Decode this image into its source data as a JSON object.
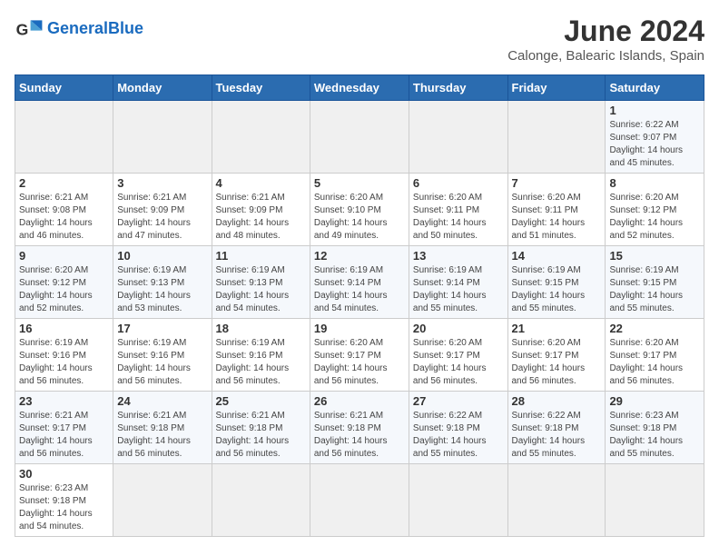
{
  "logo": {
    "text_general": "General",
    "text_blue": "Blue"
  },
  "title": "June 2024",
  "location": "Calonge, Balearic Islands, Spain",
  "days_of_week": [
    "Sunday",
    "Monday",
    "Tuesday",
    "Wednesday",
    "Thursday",
    "Friday",
    "Saturday"
  ],
  "weeks": [
    [
      {
        "day": "",
        "info": ""
      },
      {
        "day": "",
        "info": ""
      },
      {
        "day": "",
        "info": ""
      },
      {
        "day": "",
        "info": ""
      },
      {
        "day": "",
        "info": ""
      },
      {
        "day": "",
        "info": ""
      },
      {
        "day": "1",
        "info": "Sunrise: 6:22 AM\nSunset: 9:07 PM\nDaylight: 14 hours and 45 minutes."
      }
    ],
    [
      {
        "day": "2",
        "info": "Sunrise: 6:21 AM\nSunset: 9:08 PM\nDaylight: 14 hours and 46 minutes."
      },
      {
        "day": "3",
        "info": "Sunrise: 6:21 AM\nSunset: 9:09 PM\nDaylight: 14 hours and 47 minutes."
      },
      {
        "day": "4",
        "info": "Sunrise: 6:21 AM\nSunset: 9:09 PM\nDaylight: 14 hours and 48 minutes."
      },
      {
        "day": "5",
        "info": "Sunrise: 6:20 AM\nSunset: 9:10 PM\nDaylight: 14 hours and 49 minutes."
      },
      {
        "day": "6",
        "info": "Sunrise: 6:20 AM\nSunset: 9:11 PM\nDaylight: 14 hours and 50 minutes."
      },
      {
        "day": "7",
        "info": "Sunrise: 6:20 AM\nSunset: 9:11 PM\nDaylight: 14 hours and 51 minutes."
      },
      {
        "day": "8",
        "info": "Sunrise: 6:20 AM\nSunset: 9:12 PM\nDaylight: 14 hours and 52 minutes."
      }
    ],
    [
      {
        "day": "9",
        "info": "Sunrise: 6:20 AM\nSunset: 9:12 PM\nDaylight: 14 hours and 52 minutes."
      },
      {
        "day": "10",
        "info": "Sunrise: 6:19 AM\nSunset: 9:13 PM\nDaylight: 14 hours and 53 minutes."
      },
      {
        "day": "11",
        "info": "Sunrise: 6:19 AM\nSunset: 9:13 PM\nDaylight: 14 hours and 54 minutes."
      },
      {
        "day": "12",
        "info": "Sunrise: 6:19 AM\nSunset: 9:14 PM\nDaylight: 14 hours and 54 minutes."
      },
      {
        "day": "13",
        "info": "Sunrise: 6:19 AM\nSunset: 9:14 PM\nDaylight: 14 hours and 55 minutes."
      },
      {
        "day": "14",
        "info": "Sunrise: 6:19 AM\nSunset: 9:15 PM\nDaylight: 14 hours and 55 minutes."
      },
      {
        "day": "15",
        "info": "Sunrise: 6:19 AM\nSunset: 9:15 PM\nDaylight: 14 hours and 55 minutes."
      }
    ],
    [
      {
        "day": "16",
        "info": "Sunrise: 6:19 AM\nSunset: 9:16 PM\nDaylight: 14 hours and 56 minutes."
      },
      {
        "day": "17",
        "info": "Sunrise: 6:19 AM\nSunset: 9:16 PM\nDaylight: 14 hours and 56 minutes."
      },
      {
        "day": "18",
        "info": "Sunrise: 6:19 AM\nSunset: 9:16 PM\nDaylight: 14 hours and 56 minutes."
      },
      {
        "day": "19",
        "info": "Sunrise: 6:20 AM\nSunset: 9:17 PM\nDaylight: 14 hours and 56 minutes."
      },
      {
        "day": "20",
        "info": "Sunrise: 6:20 AM\nSunset: 9:17 PM\nDaylight: 14 hours and 56 minutes."
      },
      {
        "day": "21",
        "info": "Sunrise: 6:20 AM\nSunset: 9:17 PM\nDaylight: 14 hours and 56 minutes."
      },
      {
        "day": "22",
        "info": "Sunrise: 6:20 AM\nSunset: 9:17 PM\nDaylight: 14 hours and 56 minutes."
      }
    ],
    [
      {
        "day": "23",
        "info": "Sunrise: 6:21 AM\nSunset: 9:17 PM\nDaylight: 14 hours and 56 minutes."
      },
      {
        "day": "24",
        "info": "Sunrise: 6:21 AM\nSunset: 9:18 PM\nDaylight: 14 hours and 56 minutes."
      },
      {
        "day": "25",
        "info": "Sunrise: 6:21 AM\nSunset: 9:18 PM\nDaylight: 14 hours and 56 minutes."
      },
      {
        "day": "26",
        "info": "Sunrise: 6:21 AM\nSunset: 9:18 PM\nDaylight: 14 hours and 56 minutes."
      },
      {
        "day": "27",
        "info": "Sunrise: 6:22 AM\nSunset: 9:18 PM\nDaylight: 14 hours and 55 minutes."
      },
      {
        "day": "28",
        "info": "Sunrise: 6:22 AM\nSunset: 9:18 PM\nDaylight: 14 hours and 55 minutes."
      },
      {
        "day": "29",
        "info": "Sunrise: 6:23 AM\nSunset: 9:18 PM\nDaylight: 14 hours and 55 minutes."
      }
    ],
    [
      {
        "day": "30",
        "info": "Sunrise: 6:23 AM\nSunset: 9:18 PM\nDaylight: 14 hours and 54 minutes."
      },
      {
        "day": "",
        "info": ""
      },
      {
        "day": "",
        "info": ""
      },
      {
        "day": "",
        "info": ""
      },
      {
        "day": "",
        "info": ""
      },
      {
        "day": "",
        "info": ""
      },
      {
        "day": "",
        "info": ""
      }
    ]
  ]
}
